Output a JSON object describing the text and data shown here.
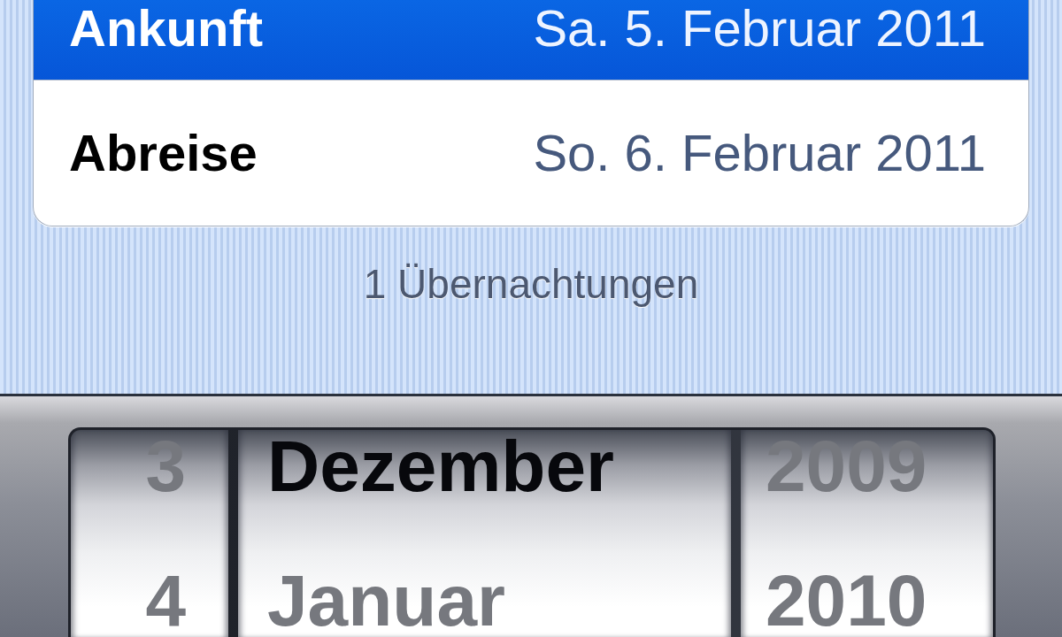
{
  "form": {
    "rows": [
      {
        "label": "Ankunft",
        "value": "Sa. 5. Februar 2011",
        "selected": true
      },
      {
        "label": "Abreise",
        "value": "So. 6. Februar 2011",
        "selected": false
      }
    ]
  },
  "nights_note": "1 Übernachtungen",
  "date_picker": {
    "columns": [
      {
        "kind": "day",
        "items": [
          {
            "text": "3",
            "disabled": true
          },
          {
            "text": "4",
            "disabled": true
          }
        ]
      },
      {
        "kind": "month",
        "items": [
          {
            "text": "Dezember",
            "disabled": false
          },
          {
            "text": "Januar",
            "disabled": true
          }
        ]
      },
      {
        "kind": "year",
        "items": [
          {
            "text": "2009",
            "disabled": true
          },
          {
            "text": "2010",
            "disabled": true
          }
        ]
      }
    ]
  }
}
